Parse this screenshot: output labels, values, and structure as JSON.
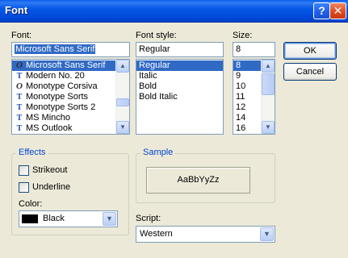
{
  "window": {
    "title": "Font",
    "help_glyph": "?",
    "close_glyph": "✕"
  },
  "font": {
    "label": "Font:",
    "value": "Microsoft Sans Serif",
    "items": [
      {
        "name": "Microsoft Sans Serif",
        "icon": "opentype-icon"
      },
      {
        "name": "Modern No. 20",
        "icon": "truetype-icon"
      },
      {
        "name": "Monotype Corsiva",
        "icon": "opentype-icon"
      },
      {
        "name": "Monotype Sorts",
        "icon": "truetype-icon"
      },
      {
        "name": "Monotype Sorts 2",
        "icon": "truetype-icon"
      },
      {
        "name": "MS Mincho",
        "icon": "truetype-icon"
      },
      {
        "name": "MS Outlook",
        "icon": "truetype-icon"
      }
    ]
  },
  "style": {
    "label": "Font style:",
    "value": "Regular",
    "items": [
      "Regular",
      "Italic",
      "Bold",
      "Bold Italic"
    ]
  },
  "size": {
    "label": "Size:",
    "value": "8",
    "items": [
      "8",
      "9",
      "10",
      "11",
      "12",
      "14",
      "16"
    ]
  },
  "buttons": {
    "ok": "OK",
    "cancel": "Cancel"
  },
  "effects": {
    "title": "Effects",
    "strikeout": "Strikeout",
    "underline": "Underline",
    "color_label": "Color:",
    "color_value": "Black",
    "color_swatch": "#000000"
  },
  "sample": {
    "title": "Sample",
    "text": "AaBbYyZz"
  },
  "script": {
    "label": "Script:",
    "value": "Western"
  },
  "icons": {
    "opentype": "O",
    "truetype": "T",
    "arrow_up": "▲",
    "arrow_down": "▼"
  }
}
